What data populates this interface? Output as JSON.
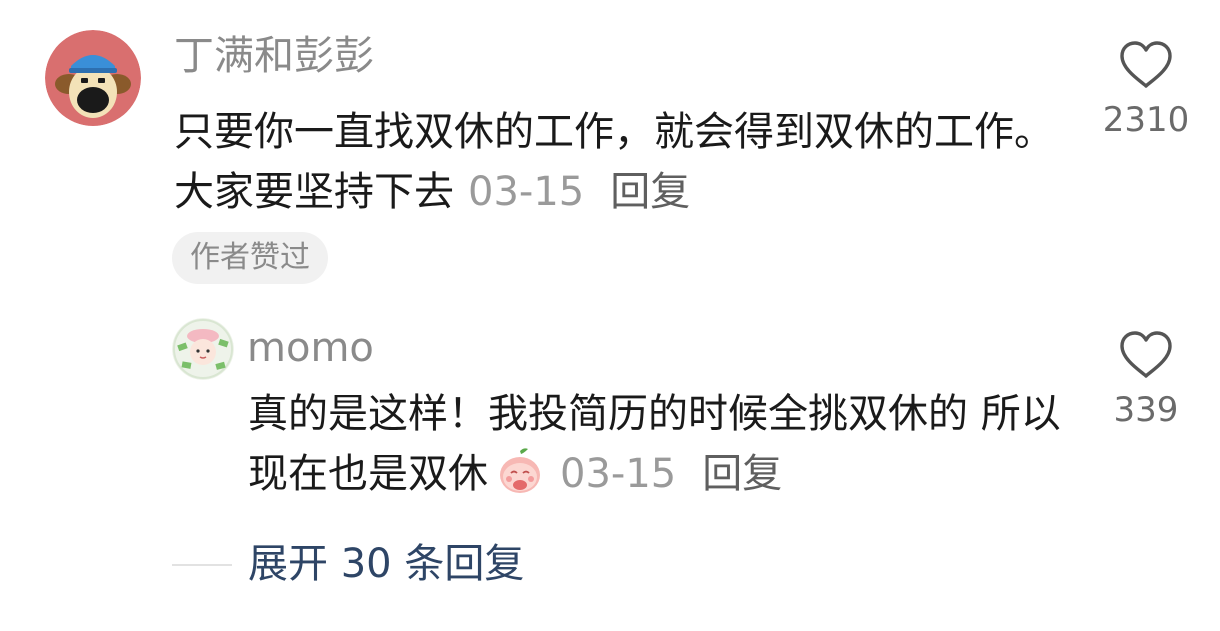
{
  "comment": {
    "username": "丁满和彭彭",
    "content": "只要你一直找双休的工作，就会得到双休的工作。大家要坚持下去",
    "date": "03-15",
    "reply_label": "回复",
    "author_liked_badge": "作者赞过",
    "like_count": "2310",
    "avatar_icon": "cartoon-dog-with-blue-cap"
  },
  "reply": {
    "username": "momo",
    "content": "真的是这样！我投简历的时候全挑双休的 所以现在也是双休",
    "emoji_icon": "peach-emoji",
    "date": "03-15",
    "reply_label": "回复",
    "like_count": "339",
    "avatar_icon": "green-girl-sticker"
  },
  "expand_replies_label": "展开 30 条回复",
  "colors": {
    "username": "#8a8a8a",
    "content": "#1a1a1a",
    "date": "#9a9a9a",
    "expand_link": "#2e4566",
    "avatar_main_bg": "#d96f6f"
  }
}
